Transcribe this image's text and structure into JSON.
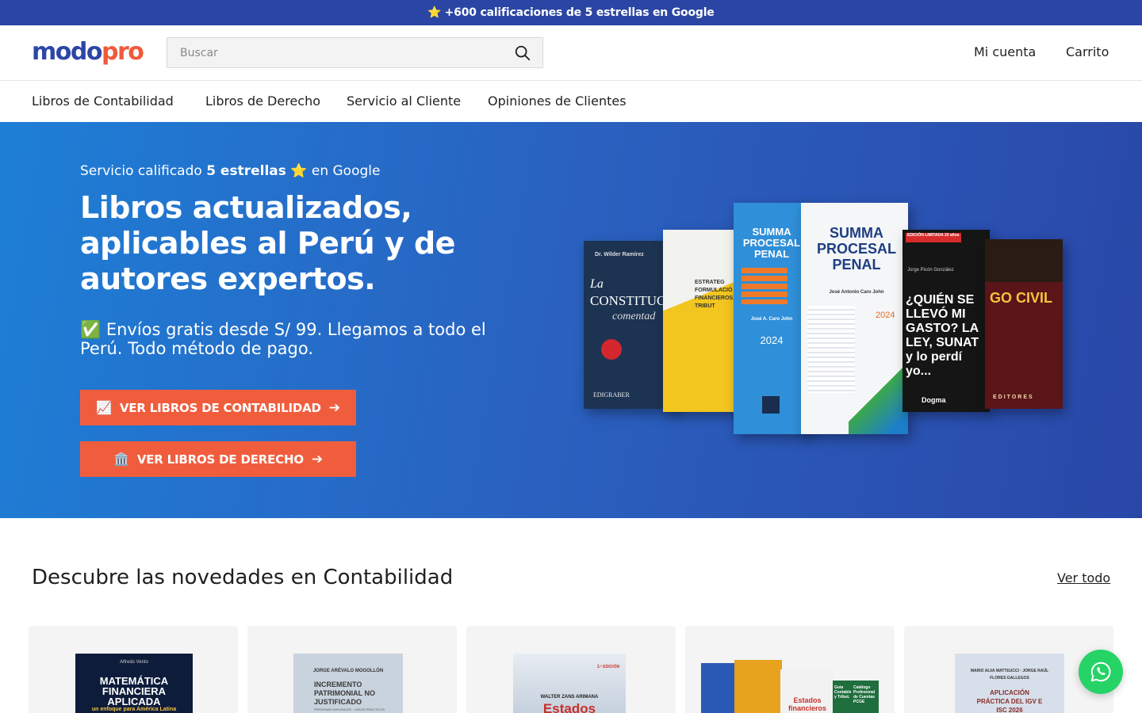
{
  "announcement": {
    "star": "⭐",
    "text": "+600 calificaciones de 5 estrellas en Google"
  },
  "header": {
    "logo_part1": "modo",
    "logo_part2": "pro",
    "search_placeholder": "Buscar",
    "account_label": "Mi cuenta",
    "cart_label": "Carrito"
  },
  "nav": {
    "items": [
      {
        "label": "Libros de Contabilidad"
      },
      {
        "label": "Libros de Derecho"
      },
      {
        "label": "Servicio al Cliente"
      },
      {
        "label": "Opiniones de Clientes"
      }
    ]
  },
  "hero": {
    "tag_prefix": "Servicio calificado",
    "tag_bold": "5 estrellas",
    "tag_star": "⭐",
    "tag_suffix": "en Google",
    "title": "Libros actualizados, aplicables al Perú y de autores expertos.",
    "subtitle": "✅ Envíos gratis desde S/ 99. Llegamos a todo el Perú. Todo método de pago.",
    "button_accounting": {
      "icon": "📈",
      "label": "VER LIBROS DE CONTABILIDAD",
      "arrow": "➔"
    },
    "button_law": {
      "icon": "🏛️",
      "label": "VER LIBROS DE DERECHO",
      "arrow": "➔"
    },
    "book_covers": {
      "b1_author": "Dr. Wilder Ramírez",
      "b1_title1": "La",
      "b1_title2": "CONSTITUC",
      "b1_title3": "comentad",
      "b1_publisher": "EDIGRABER",
      "b2_title": "ESTRATEG FORMULACIÓ FINANCIEROS, C Y TRIBUT",
      "b3_title": "SUMMA PROCESAL PENAL",
      "b3_author": "José A. Caro John",
      "b3_year": "2024",
      "b4_title": "SUMMA PROCESAL PENAL",
      "b4_author": "José Antonio Caro John",
      "b4_year": "2024",
      "b5_badge": "EDICIÓN LIMITADA 20 años",
      "b5_author": "Jorge Picón González",
      "b5_title": "¿QUIÉN SE LLEVÓ MI GASTO? LA LEY, SUNAT y lo perdí yo...",
      "b5_publisher": "Dogma",
      "b6_title": "GO CIVIL",
      "b6_publisher": "EDITORES"
    }
  },
  "section": {
    "title": "Descubre las novedades en Contabilidad",
    "view_all": "Ver todo"
  },
  "products": [
    {
      "author": "Alfredo Vento",
      "title": "MATEMÁTICA FINANCIERA APLICADA",
      "subtitle": "un enfoque para América Latina"
    },
    {
      "author": "JORGE ARÉVALO MOGOLLÓN",
      "title": "INCREMENTO PATRIMONIAL NO JUSTIFICADO",
      "subtitle": "PERSONAS NATURALES · CASOS PRÁCTICOS"
    },
    {
      "author": "WALTER ZANS ARIMANA",
      "title": "Estados",
      "edition": "3.ª EDICIÓN"
    },
    {
      "title": "Estados financieros",
      "title2": "Guía Contable y Tribut.",
      "title3": "Catálogo Profesional de Cuentas PCGE"
    },
    {
      "author": "MARIO ALVA MATTEUCCI · JORGE RAÚL FLORES GALLEGOS",
      "title": "APLICACIÓN PRÁCTICA DEL IGV E ISC 2026"
    }
  ],
  "colors": {
    "brand_blue": "#2c46a6",
    "brand_orange": "#ef5a3a",
    "announcement_bg": "#2a45a3",
    "button_bg": "#f05d3d",
    "whatsapp": "#25d366"
  },
  "icons": {
    "search": "search-icon",
    "whatsapp": "whatsapp-icon"
  }
}
